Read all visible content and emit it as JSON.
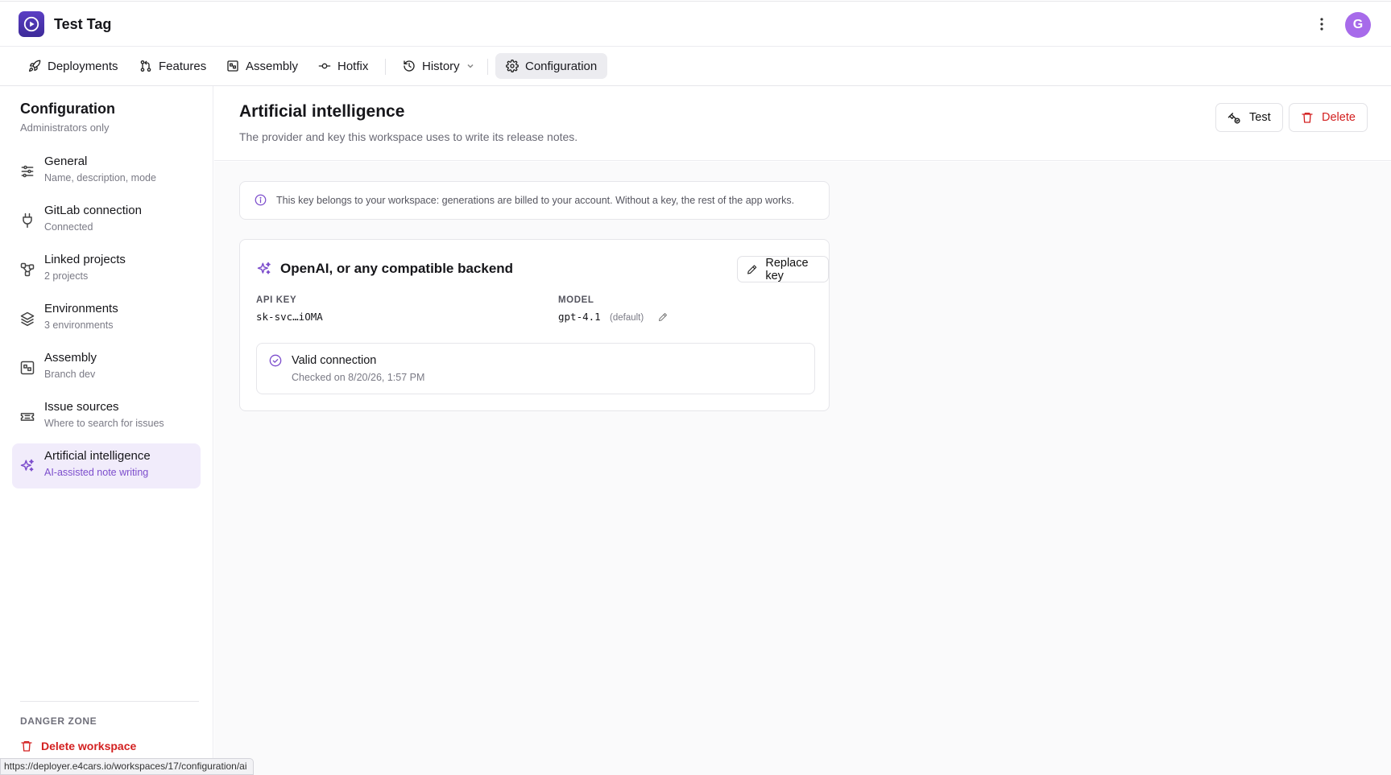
{
  "app": {
    "name": "Test Tag"
  },
  "user": {
    "avatar_initial": "G"
  },
  "nav": {
    "tabs": [
      {
        "label": "Deployments",
        "icon": "rocket-icon"
      },
      {
        "label": "Features",
        "icon": "merge-icon"
      },
      {
        "label": "Assembly",
        "icon": "assembly-icon"
      },
      {
        "label": "Hotfix",
        "icon": "commit-icon"
      },
      {
        "label": "History",
        "icon": "history-icon"
      },
      {
        "label": "Configuration",
        "icon": "gear-icon",
        "active": true
      }
    ]
  },
  "sidebar": {
    "title": "Configuration",
    "subtitle": "Administrators only",
    "items": [
      {
        "label": "General",
        "description": "Name, description, mode",
        "icon": "sliders-icon"
      },
      {
        "label": "GitLab connection",
        "description": "Connected",
        "icon": "plug-icon"
      },
      {
        "label": "Linked projects",
        "description": "2 projects",
        "icon": "nodes-icon"
      },
      {
        "label": "Environments",
        "description": "3 environments",
        "icon": "layers-icon"
      },
      {
        "label": "Assembly",
        "description": "Branch dev",
        "icon": "assembly-icon"
      },
      {
        "label": "Issue sources",
        "description": "Where to search for issues",
        "icon": "ticket-icon"
      },
      {
        "label": "Artificial intelligence",
        "description": "AI-assisted note writing",
        "icon": "sparkles-icon",
        "active": true
      }
    ],
    "danger_zone": {
      "title": "DANGER ZONE",
      "delete_label": "Delete workspace"
    }
  },
  "main": {
    "title": "Artificial intelligence",
    "subtitle": "The provider and key this workspace uses to write its release notes.",
    "test_label": "Test",
    "delete_label": "Delete",
    "info": "This key belongs to your workspace: generations are billed to your account. Without a key, the rest of the app works.",
    "card": {
      "title": "OpenAI, or any compatible backend",
      "replace_label": "Replace key",
      "api_key_label": "API KEY",
      "api_key_value": "sk-svc…iOMA",
      "model_label": "MODEL",
      "model_value": "gpt-4.1",
      "model_default": "(default)",
      "status_title": "Valid connection",
      "status_checked": "Checked on 8/20/26, 1:57 PM"
    }
  },
  "status_url": "https://deployer.e4cars.io/workspaces/17/configuration/ai",
  "colors": {
    "accent": "#7c4dcc",
    "danger": "#d32020",
    "logo": "#4a33b0",
    "avatar": "#a76bea"
  }
}
